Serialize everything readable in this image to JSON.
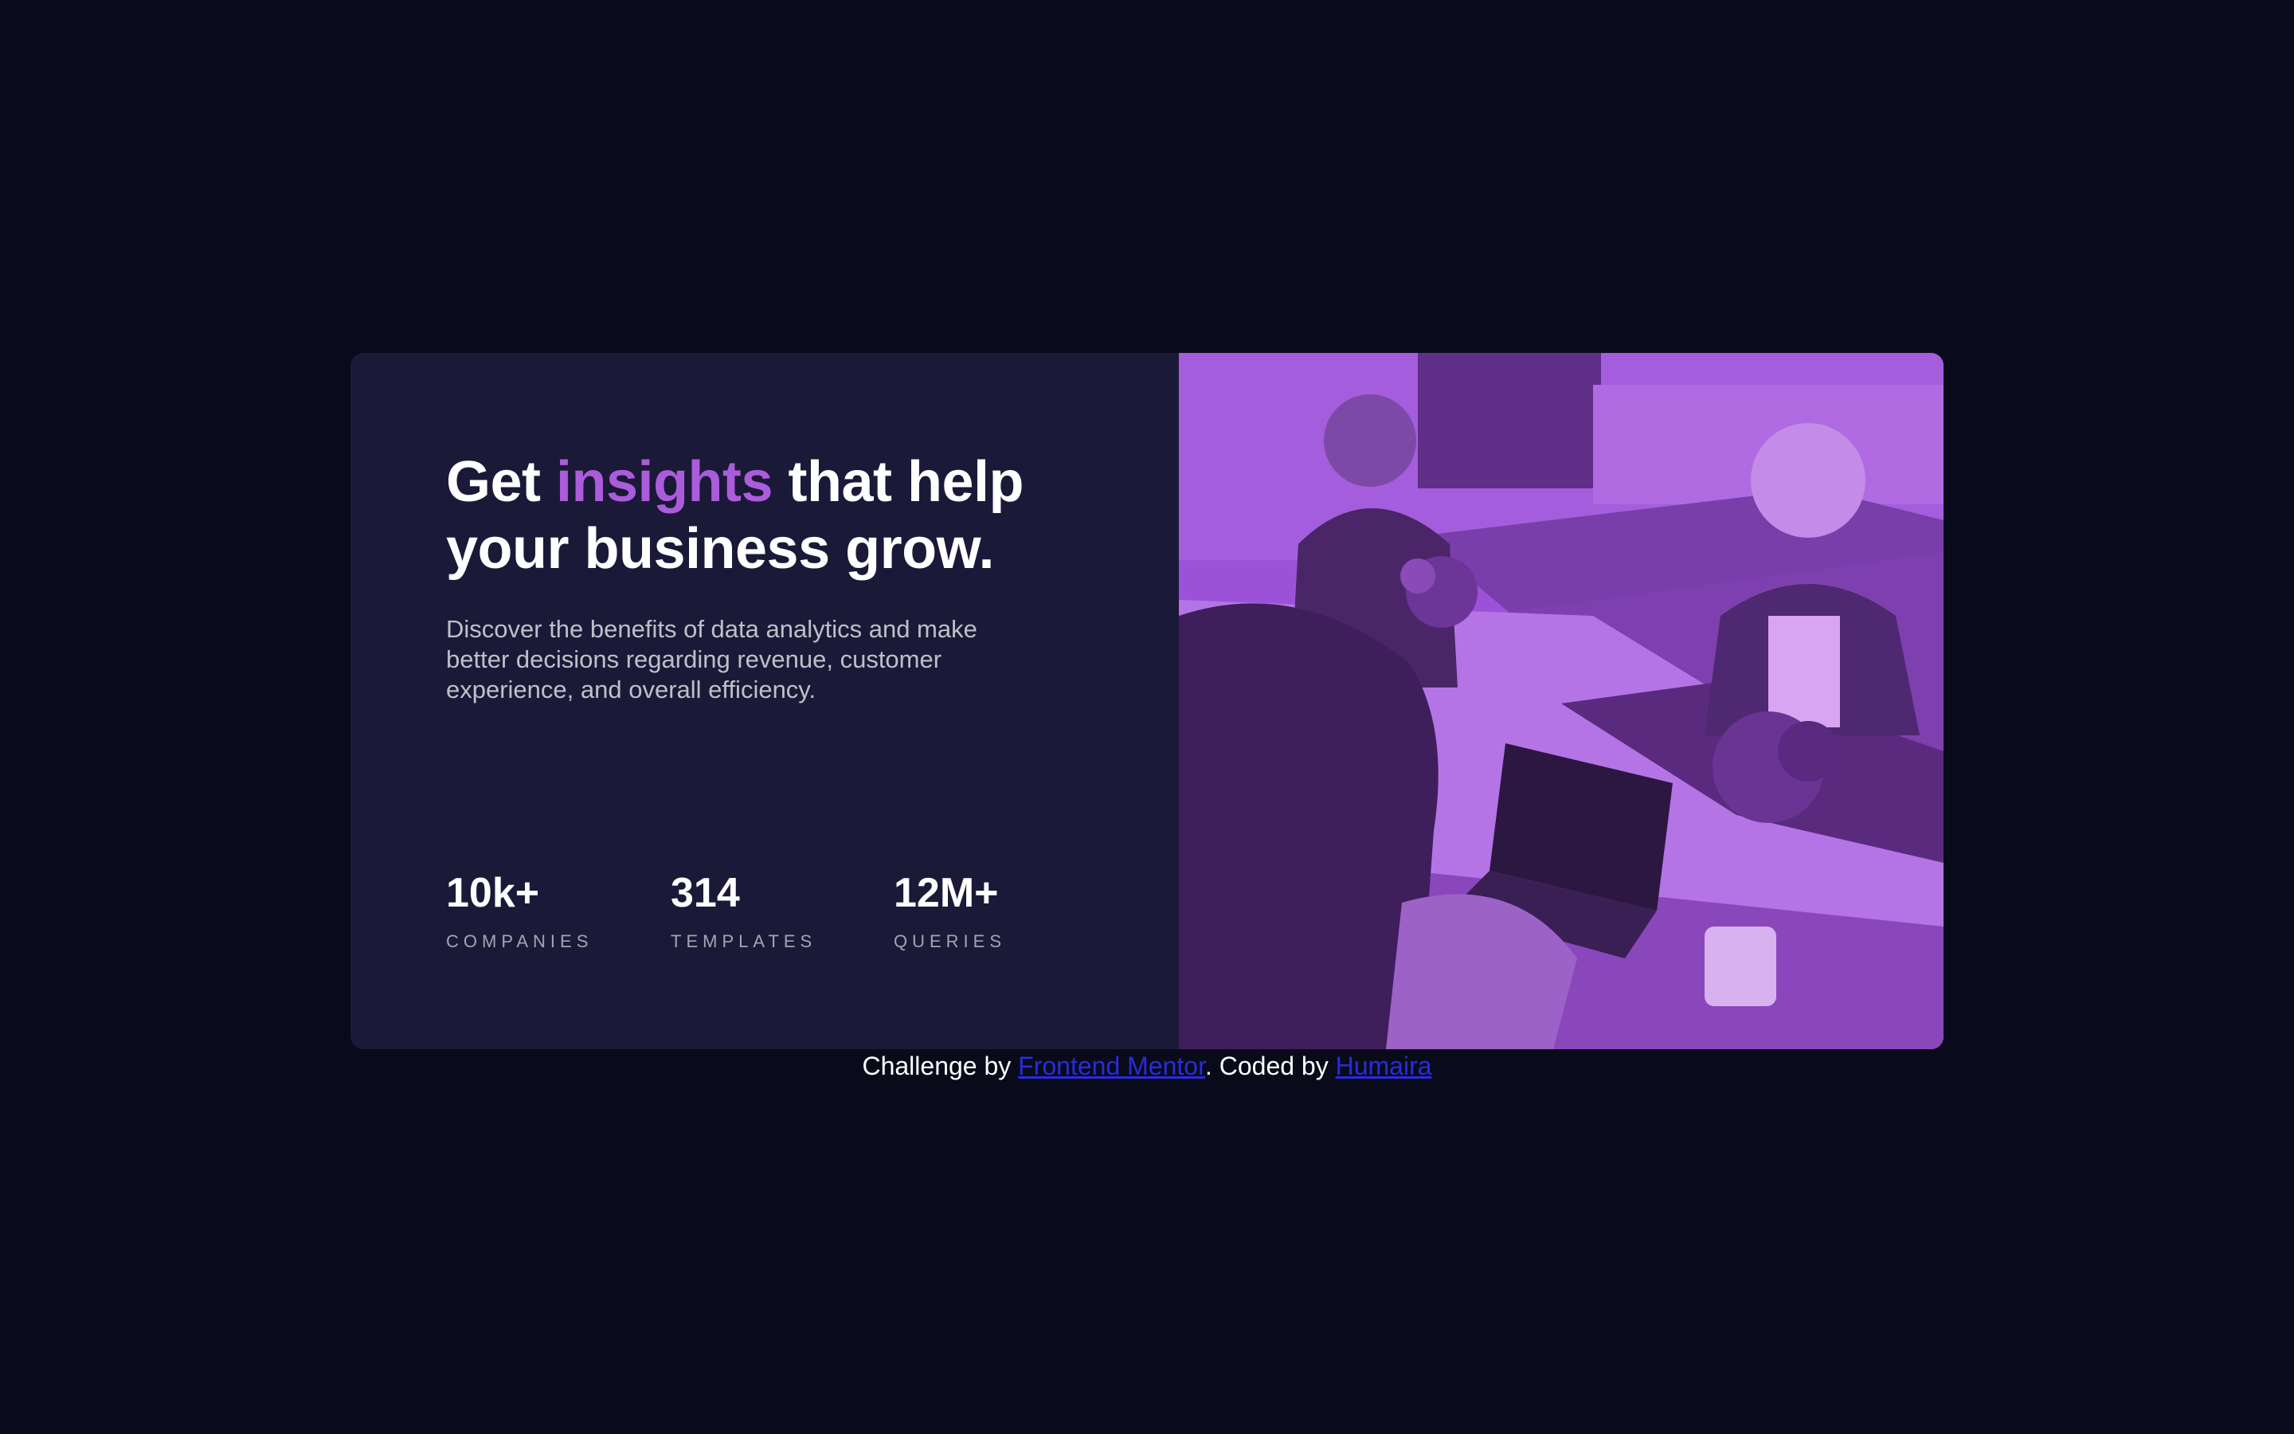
{
  "card": {
    "headline": {
      "part1": "Get ",
      "accent": "insights",
      "part2": " that help your business grow."
    },
    "description": "Discover the benefits of data analytics and make better decisions regarding revenue, customer experience, and overall efficiency.",
    "stats": [
      {
        "value": "10k+",
        "label": "COMPANIES"
      },
      {
        "value": "314",
        "label": "TEMPLATES"
      },
      {
        "value": "12M+",
        "label": "QUERIES"
      }
    ]
  },
  "footer": {
    "prefix": "Challenge by ",
    "link1": "Frontend Mentor",
    "middle": ". Coded by ",
    "link2": "Humaira"
  },
  "colors": {
    "page_background": "#090b1a",
    "card_background": "#1b1938",
    "accent": "#ab5cdb",
    "image_overlay": "#9c52d8"
  }
}
